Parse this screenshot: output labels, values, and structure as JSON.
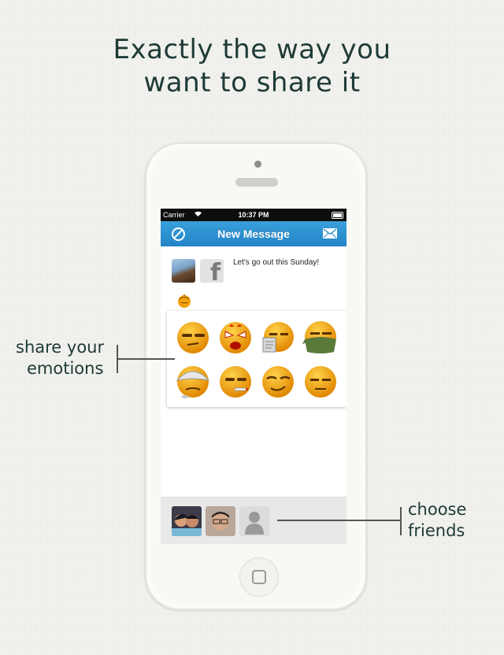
{
  "headline": {
    "line1": "Exactly the way you",
    "line2": "want to share it"
  },
  "status_bar": {
    "carrier": "Carrier",
    "time": "10:37 PM"
  },
  "nav": {
    "title": "New Message",
    "left_icon": "cancel-circle-icon",
    "right_icon": "envelope-icon"
  },
  "message": {
    "text": "Let's go out this Sunday!",
    "fb_letter": "f"
  },
  "emoticons": [
    {
      "name": "smug-emoticon"
    },
    {
      "name": "angry-emoticon"
    },
    {
      "name": "reading-emoticon"
    },
    {
      "name": "ninja-emoticon"
    },
    {
      "name": "dizzy-emoticon"
    },
    {
      "name": "smoking-emoticon"
    },
    {
      "name": "sly-emoticon"
    },
    {
      "name": "bored-emoticon"
    }
  ],
  "friends": [
    {
      "name": "couple-photo"
    },
    {
      "name": "friend-photo"
    },
    {
      "name": "placeholder-person-icon"
    }
  ],
  "callouts": {
    "emotions_line1": "share your",
    "emotions_line2": "emotions",
    "friends_line1": "choose",
    "friends_line2": "friends"
  },
  "colors": {
    "nav_blue": "#2a8fd0",
    "headline": "#1e3a36",
    "emoticon_yellow": "#f5a10c"
  }
}
